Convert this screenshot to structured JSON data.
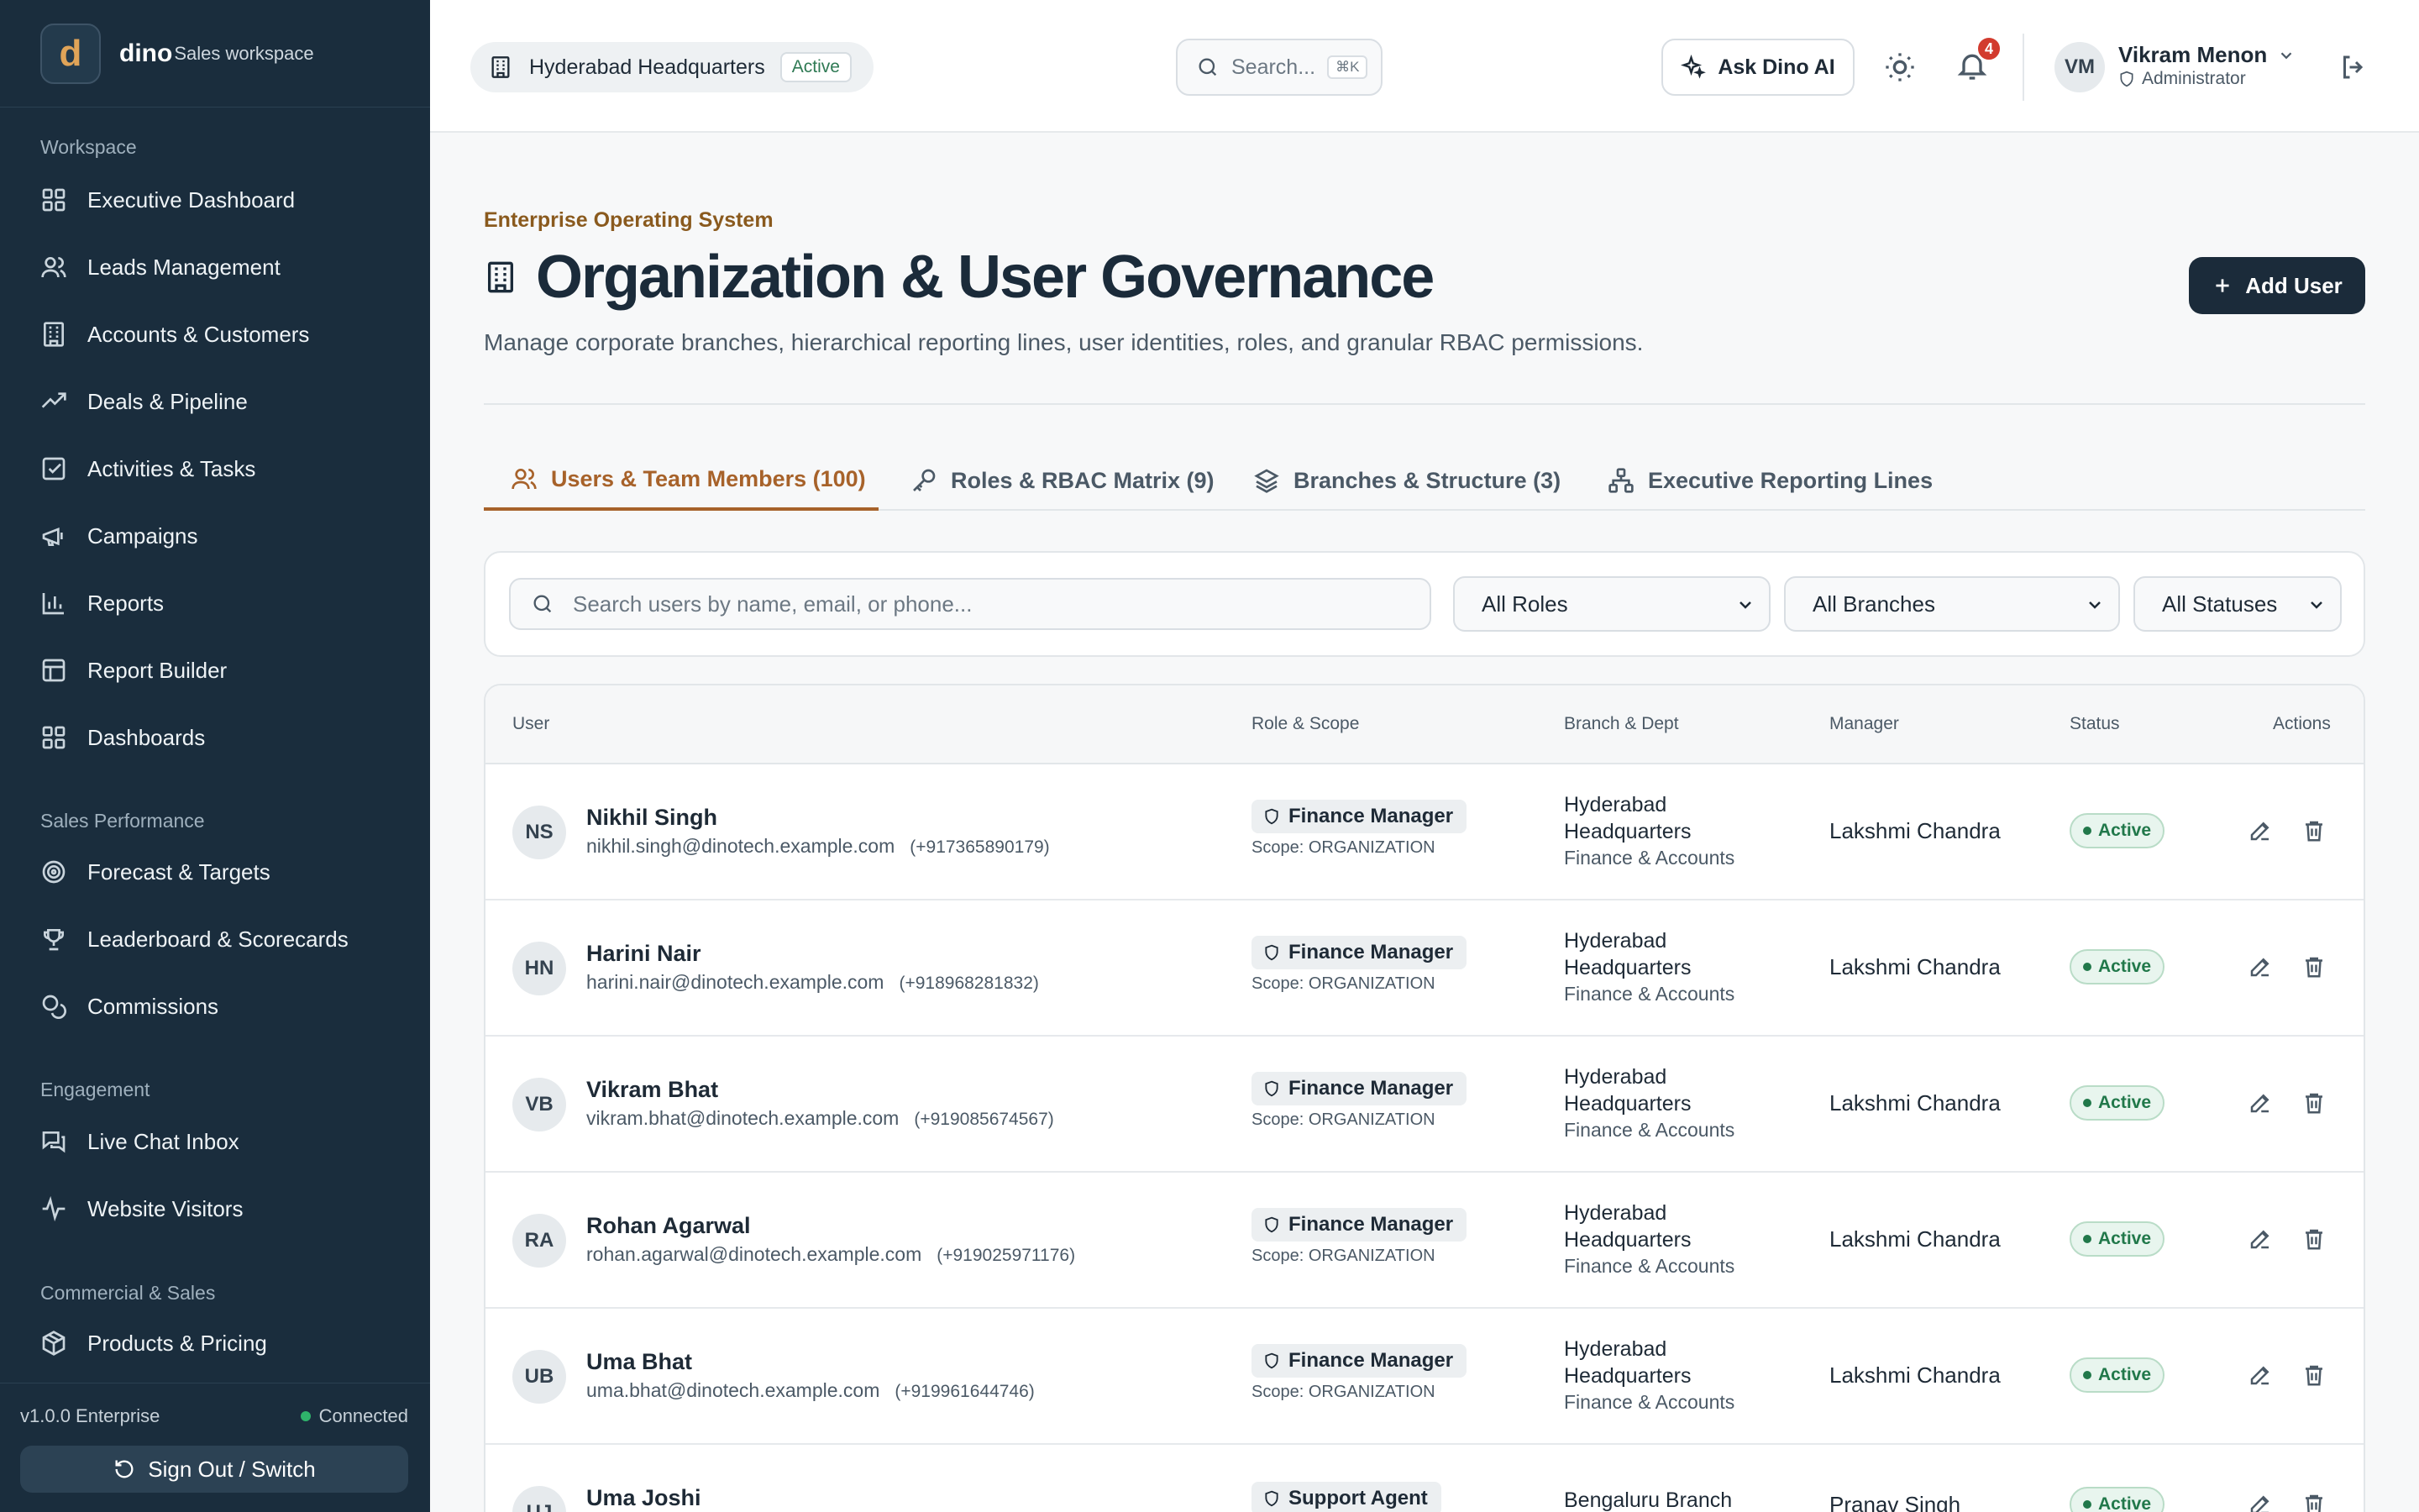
{
  "sidebar": {
    "logo_letter": "d",
    "brand": "dino",
    "brand_sub": "Sales workspace",
    "sections": [
      {
        "title": "Workspace",
        "items": [
          {
            "label": "Executive Dashboard",
            "icon": "grid-icon"
          },
          {
            "label": "Leads Management",
            "icon": "users-icon"
          },
          {
            "label": "Accounts & Customers",
            "icon": "building-icon"
          },
          {
            "label": "Deals & Pipeline",
            "icon": "trend-icon"
          },
          {
            "label": "Activities & Tasks",
            "icon": "checkbox-icon"
          },
          {
            "label": "Campaigns",
            "icon": "megaphone-icon"
          },
          {
            "label": "Reports",
            "icon": "bar-chart-icon"
          },
          {
            "label": "Report Builder",
            "icon": "table-icon"
          },
          {
            "label": "Dashboards",
            "icon": "grid-icon"
          }
        ]
      },
      {
        "title": "Sales Performance",
        "items": [
          {
            "label": "Forecast & Targets",
            "icon": "target-icon"
          },
          {
            "label": "Leaderboard & Scorecards",
            "icon": "trophy-icon"
          },
          {
            "label": "Commissions",
            "icon": "coins-icon"
          }
        ]
      },
      {
        "title": "Engagement",
        "items": [
          {
            "label": "Live Chat Inbox",
            "icon": "chat-icon"
          },
          {
            "label": "Website Visitors",
            "icon": "activity-icon"
          }
        ]
      },
      {
        "title": "Commercial & Sales",
        "items": [
          {
            "label": "Products & Pricing",
            "icon": "package-icon"
          }
        ]
      }
    ],
    "version": "v1.0.0 Enterprise",
    "connection": "Connected",
    "signout": "Sign Out / Switch"
  },
  "topbar": {
    "location": "Hyderabad Headquarters",
    "location_badge": "Active",
    "search_placeholder": "Search...",
    "search_shortcut": "⌘K",
    "ask_ai": "Ask Dino AI",
    "notifications_count": "4",
    "user_initials": "VM",
    "user_name": "Vikram Menon",
    "user_role": "Administrator"
  },
  "page": {
    "eyebrow": "Enterprise Operating System",
    "title": "Organization & User Governance",
    "description": "Manage corporate branches, hierarchical reporting lines, user identities, roles, and granular RBAC permissions.",
    "add_user": "Add User"
  },
  "tabs": [
    {
      "label": "Users & Team Members (100)",
      "icon": "users-icon",
      "active": true
    },
    {
      "label": "Roles & RBAC Matrix (9)",
      "icon": "key-icon",
      "active": false
    },
    {
      "label": "Branches & Structure (3)",
      "icon": "layers-icon",
      "active": false
    },
    {
      "label": "Executive Reporting Lines",
      "icon": "hierarchy-icon",
      "active": false
    }
  ],
  "filters": {
    "search_placeholder": "Search users by name, email, or phone...",
    "role": "All Roles",
    "branch": "All Branches",
    "status": "All Statuses"
  },
  "table": {
    "columns": [
      "User",
      "Role & Scope",
      "Branch & Dept",
      "Manager",
      "Status",
      "Actions"
    ],
    "rows": [
      {
        "initials": "NS",
        "name": "Nikhil Singh",
        "email": "nikhil.singh@dinotech.example.com",
        "phone": "(+917365890179)",
        "role": "Finance Manager",
        "scope": "Scope: ORGANIZATION",
        "branch": "Hyderabad Headquarters",
        "dept": "Finance & Accounts",
        "manager": "Lakshmi Chandra",
        "status": "Active"
      },
      {
        "initials": "HN",
        "name": "Harini Nair",
        "email": "harini.nair@dinotech.example.com",
        "phone": "(+918968281832)",
        "role": "Finance Manager",
        "scope": "Scope: ORGANIZATION",
        "branch": "Hyderabad Headquarters",
        "dept": "Finance & Accounts",
        "manager": "Lakshmi Chandra",
        "status": "Active"
      },
      {
        "initials": "VB",
        "name": "Vikram Bhat",
        "email": "vikram.bhat@dinotech.example.com",
        "phone": "(+919085674567)",
        "role": "Finance Manager",
        "scope": "Scope: ORGANIZATION",
        "branch": "Hyderabad Headquarters",
        "dept": "Finance & Accounts",
        "manager": "Lakshmi Chandra",
        "status": "Active"
      },
      {
        "initials": "RA",
        "name": "Rohan Agarwal",
        "email": "rohan.agarwal@dinotech.example.com",
        "phone": "(+919025971176)",
        "role": "Finance Manager",
        "scope": "Scope: ORGANIZATION",
        "branch": "Hyderabad Headquarters",
        "dept": "Finance & Accounts",
        "manager": "Lakshmi Chandra",
        "status": "Active"
      },
      {
        "initials": "UB",
        "name": "Uma Bhat",
        "email": "uma.bhat@dinotech.example.com",
        "phone": "(+919961644746)",
        "role": "Finance Manager",
        "scope": "Scope: ORGANIZATION",
        "branch": "Hyderabad Headquarters",
        "dept": "Finance & Accounts",
        "manager": "Lakshmi Chandra",
        "status": "Active"
      },
      {
        "initials": "UJ",
        "name": "Uma Joshi",
        "email": "",
        "phone": "",
        "role": "Support Agent",
        "scope": "",
        "branch": "Bengaluru Branch",
        "dept": "",
        "manager": "Pranav Singh",
        "status": "Active"
      }
    ]
  },
  "colors": {
    "sidebar_bg": "#1a2d3d",
    "accent": "#a7622a",
    "primary_button": "#1b2b3a",
    "status_active": "#21784a",
    "notification_badge": "#d23b2e"
  }
}
